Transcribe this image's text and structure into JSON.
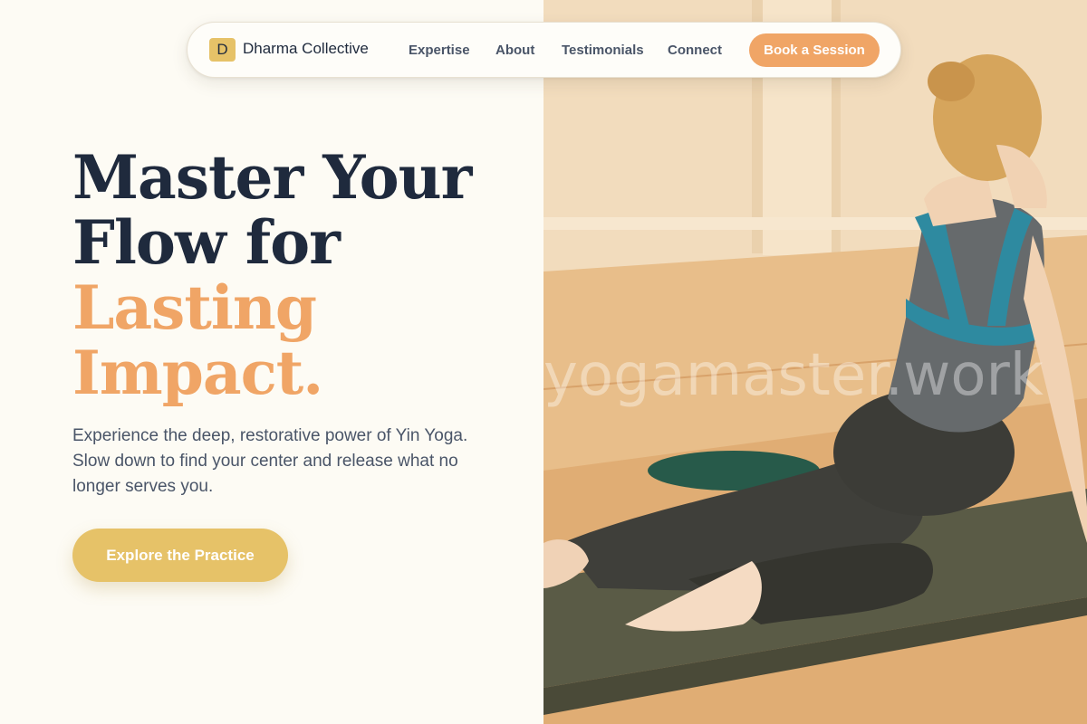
{
  "nav": {
    "logo_letter": "D",
    "brand": "Dharma Collective",
    "links": [
      "Expertise",
      "About",
      "Testimonials",
      "Connect"
    ],
    "cta_label": "Book a Session"
  },
  "hero": {
    "headline_lines": [
      "Master Your",
      "Flow for",
      "Lasting",
      "Impact."
    ],
    "lede": "Experience the deep, restorative power of Yin Yoga. Slow down to find your center and release what no longer serves you.",
    "cta_label": "Explore the Practice"
  },
  "photo": {
    "watermark": "yogamaster.work"
  },
  "colors": {
    "background": "#fdfbf4",
    "navy": "#1f2a3d",
    "orange_accent": "#f0a566",
    "gold": "#e6c268",
    "body_text": "#4a5568"
  },
  "icons": {
    "logo": "letter-d-badge"
  }
}
